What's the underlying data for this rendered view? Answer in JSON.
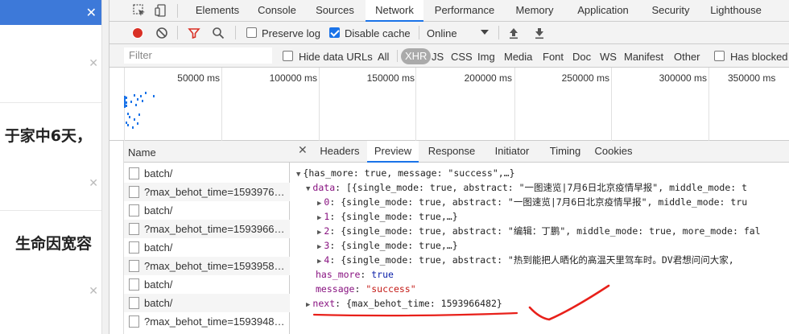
{
  "page": {
    "headline_1": "于家中6天，",
    "headline_2": "生命因宽容",
    "close_glyph": "✕"
  },
  "devtools": {
    "tabs": [
      "Elements",
      "Console",
      "Sources",
      "Network",
      "Performance",
      "Memory",
      "Application",
      "Security",
      "Lighthouse"
    ],
    "active_tab": "Network",
    "toolbar": {
      "preserve_log": "Preserve log",
      "disable_cache": "Disable cache",
      "throttle": "Online"
    },
    "filter": {
      "placeholder": "Filter",
      "hide_data_urls": "Hide data URLs",
      "types": [
        "All",
        "XHR",
        "JS",
        "CSS",
        "Img",
        "Media",
        "Font",
        "Doc",
        "WS",
        "Manifest",
        "Other"
      ],
      "active_type": "XHR",
      "has_blocked": "Has blocked"
    },
    "overview": {
      "ticks": [
        "50000 ms",
        "100000 ms",
        "150000 ms",
        "200000 ms",
        "250000 ms",
        "300000 ms",
        "350000 ms"
      ]
    },
    "requests": {
      "header": "Name",
      "rows": [
        "batch/",
        "?max_behot_time=1593976…",
        "batch/",
        "?max_behot_time=1593966…",
        "batch/",
        "?max_behot_time=1593958…",
        "batch/",
        "batch/",
        "?max_behot_time=1593948…"
      ]
    },
    "detail_tabs": [
      "Headers",
      "Preview",
      "Response",
      "Initiator",
      "Timing",
      "Cookies"
    ],
    "active_detail_tab": "Preview",
    "preview": {
      "root": "{has_more: true, message: \"success\",…}",
      "data_key": "data",
      "data_summary": "[{single_mode: true, abstract: \"一图速览|7月6日北京疫情早报\", middle_mode: t",
      "items": [
        {
          "idx": "0",
          "text": "{single_mode: true, abstract: \"一图速览|7月6日北京疫情早报\", middle_mode: tru"
        },
        {
          "idx": "1",
          "text": "{single_mode: true,…}"
        },
        {
          "idx": "2",
          "text": "{single_mode: true, abstract: \"编辑：丁鹏\", middle_mode: true, more_mode: fal"
        },
        {
          "idx": "3",
          "text": "{single_mode: true,…}"
        },
        {
          "idx": "4",
          "text": "{single_mode: true, abstract: \"热到能把人晒化的高温天里驾车时。DV君想问问大家,"
        }
      ],
      "has_more_key": "has_more",
      "has_more_val": "true",
      "message_key": "message",
      "message_val": "\"success\"",
      "next_key": "next",
      "next_val": "{max_behot_time: 1593966482}"
    },
    "colors": {
      "accent": "#1a73e8",
      "record": "#d93025",
      "annotation": "#e8201a"
    }
  }
}
